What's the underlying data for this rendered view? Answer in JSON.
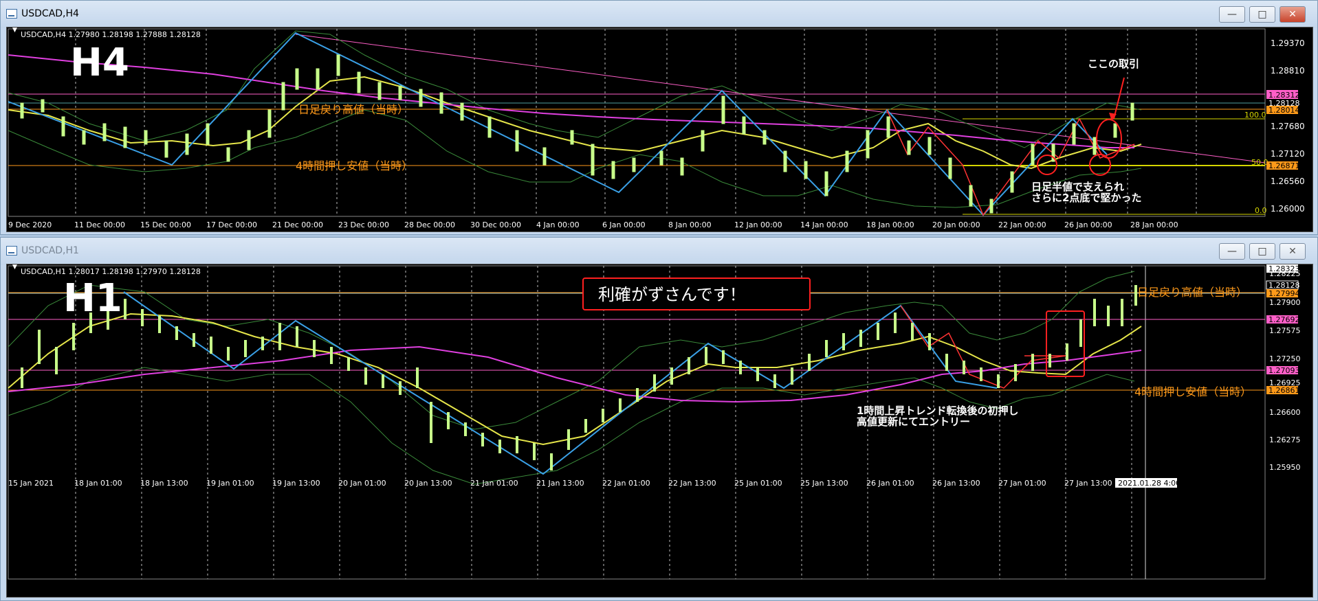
{
  "top": {
    "window_title": "USDCAD,H4",
    "header": "USDCAD,H4  1.27980 1.28198 1.27888 1.28128",
    "big_label": "H4",
    "x_labels": [
      "9 Dec 2020",
      "11 Dec 00:00",
      "15 Dec 00:00",
      "17 Dec 00:00",
      "21 Dec 00:00",
      "23 Dec 00:00",
      "28 Dec 00:00",
      "30 Dec 00:00",
      "4 Jan 00:00",
      "6 Jan 00:00",
      "8 Jan 00:00",
      "12 Jan 00:00",
      "14 Jan 00:00",
      "18 Jan 00:00",
      "20 Jan 00:00",
      "22 Jan 00:00",
      "26 Jan 00:00",
      "28 Jan 00:00"
    ],
    "y_labels": [
      "1.29370",
      "1.28810",
      "1.27680",
      "1.27120",
      "1.26560",
      "1.26000"
    ],
    "badges": {
      "pink": "1.28312",
      "white": "1.28128",
      "orange": "1.28014",
      "orange2": "1.26871"
    },
    "fib_100": "100.0",
    "fib_50": "50.0",
    "fib_0": "0.0",
    "annotations": {
      "daily_high": "日足戻り高値（当時）",
      "h4_low": "4時間押し安値（当時）",
      "trade": "ここの取引",
      "support1": "日足半値で支えられ",
      "support2": "さらに2点底で堅かった"
    }
  },
  "bottom": {
    "window_title": "USDCAD,H1",
    "header": "USDCAD,H1  1.28017 1.28198 1.27970 1.28128",
    "big_label": "H1",
    "x_labels": [
      "15 Jan 2021",
      "18 Jan 01:00",
      "18 Jan 13:00",
      "19 Jan 01:00",
      "19 Jan 13:00",
      "20 Jan 01:00",
      "20 Jan 13:00",
      "21 Jan 01:00",
      "21 Jan 13:00",
      "22 Jan 01:00",
      "22 Jan 13:00",
      "25 Jan 01:00",
      "25 Jan 13:00",
      "26 Jan 01:00",
      "26 Jan 13:00",
      "27 Jan 01:00",
      "27 Jan 13:00"
    ],
    "crosshair_label": "2021.01.28 4:00",
    "y_labels": [
      "1.28225",
      "1.27900",
      "1.27575",
      "1.27250",
      "1.26925",
      "1.26600",
      "1.26275",
      "1.25950"
    ],
    "badges": {
      "top": "1.28323",
      "white": "1.28128",
      "orange": "1.27994",
      "pink": "1.27692",
      "pink2": "1.27093",
      "orange2": "1.26861"
    },
    "annotations": {
      "profit": "利確がずさんです！",
      "daily_high": "日足戻り高値（当時）",
      "h4_low": "4時間押し安値（当時）",
      "entry1": "1時間上昇トレンド転換後の初押し",
      "entry2": "高値更新にてエントリー"
    }
  }
}
